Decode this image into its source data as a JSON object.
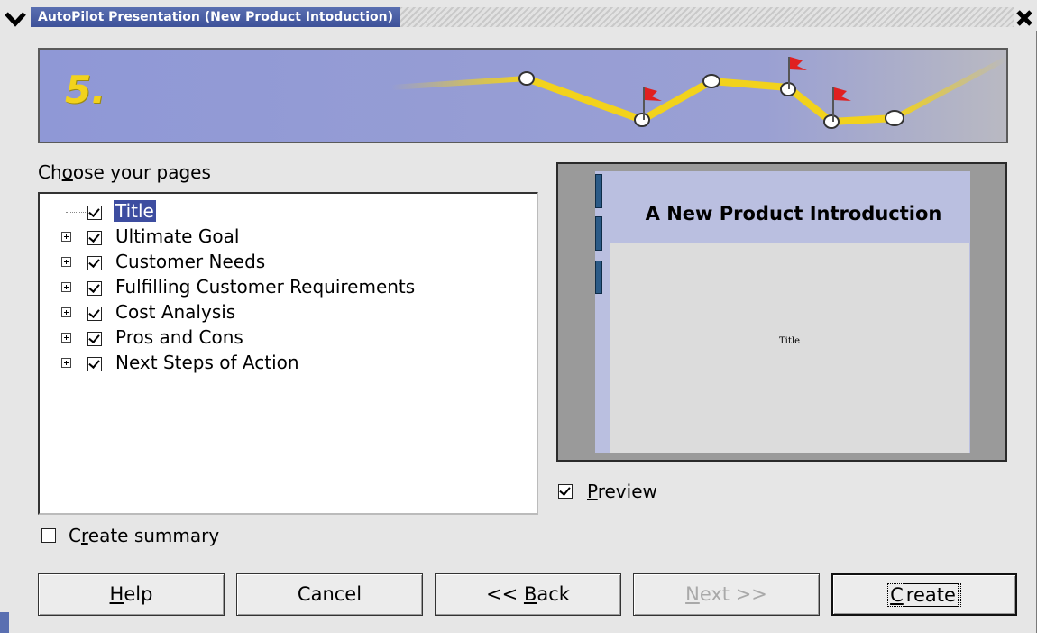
{
  "window": {
    "title": "AutoPilot Presentation (New Product Intoduction)",
    "step_number": "5."
  },
  "pages": {
    "label_prefix": "Ch",
    "label_accel": "o",
    "label_suffix": "ose your pages",
    "items": [
      {
        "label": "Title",
        "checked": true,
        "expandable": false,
        "selected": true
      },
      {
        "label": "Ultimate Goal",
        "checked": true,
        "expandable": true
      },
      {
        "label": "Customer Needs",
        "checked": true,
        "expandable": true
      },
      {
        "label": "Fulfilling Customer Requirements",
        "checked": true,
        "expandable": true
      },
      {
        "label": "Cost Analysis",
        "checked": true,
        "expandable": true
      },
      {
        "label": "Pros and Cons",
        "checked": true,
        "expandable": true
      },
      {
        "label": "Next Steps of Action",
        "checked": true,
        "expandable": true
      }
    ]
  },
  "summary": {
    "checked": false,
    "label_prefix": "C",
    "label_accel": "r",
    "label_suffix": "eate summary"
  },
  "preview": {
    "slide_title": "A New Product Introduction",
    "slide_subtitle": "Title",
    "checked": true,
    "label_accel": "P",
    "label_suffix": "review"
  },
  "buttons": {
    "help_accel": "H",
    "help_rest": "elp",
    "cancel": "Cancel",
    "back_prefix": "<< ",
    "back_accel": "B",
    "back_rest": "ack",
    "next_accel": "N",
    "next_rest": "ext >>",
    "create_accel": "C",
    "create_rest": "reate"
  },
  "colors": {
    "title_bar": "#3d5199",
    "banner_bg": "#8e97d4",
    "path_yellow": "#f2d21c",
    "selection": "#3d4da0",
    "flag_red": "#e02020"
  }
}
